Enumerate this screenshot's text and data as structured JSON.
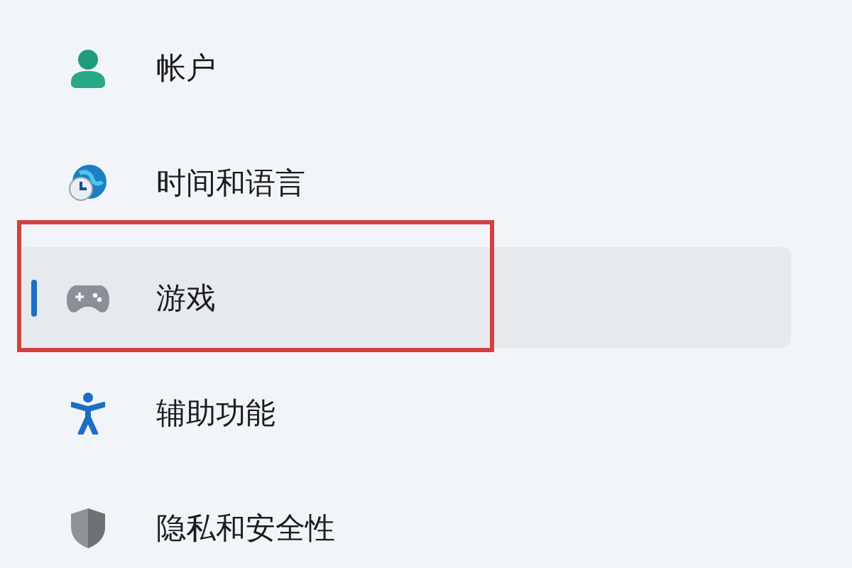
{
  "sidebar": {
    "items": [
      {
        "kind": "account",
        "label": "帐户",
        "selected": false,
        "highlighted": false
      },
      {
        "kind": "time",
        "label": "时间和语言",
        "selected": false,
        "highlighted": false
      },
      {
        "kind": "gaming",
        "label": "游戏",
        "selected": true,
        "highlighted": true
      },
      {
        "kind": "accessibility",
        "label": "辅助功能",
        "selected": false,
        "highlighted": false
      },
      {
        "kind": "privacy",
        "label": "隐私和安全性",
        "selected": false,
        "highlighted": false
      }
    ]
  }
}
